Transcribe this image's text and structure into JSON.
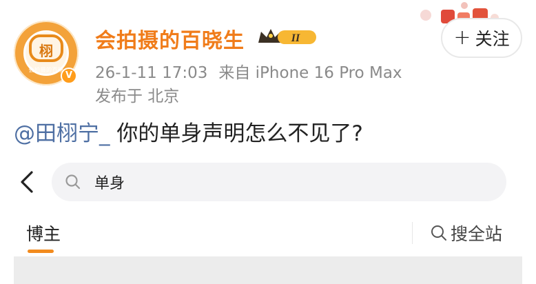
{
  "post": {
    "author": {
      "name": "会拍摄的百晓生",
      "avatar_glyph": "栩",
      "avatar_caption": "会拍摄的百晓",
      "verified_mark": "V",
      "level_badge": "II",
      "level_icon": "crown-icon"
    },
    "meta": {
      "timestamp": "26-1-11 17:03",
      "source": "来自 iPhone 16 Pro Max",
      "location": "发布于 北京"
    },
    "follow_button": {
      "plus": "+",
      "label": "关注"
    },
    "text": {
      "mention": "@田栩宁_",
      "body": " 你的单身声明怎么不见了?"
    }
  },
  "embedded_screenshot": {
    "back_icon": "chevron-left-icon",
    "search": {
      "icon": "search-icon",
      "query": "单身"
    },
    "tabs": {
      "active": "博主"
    },
    "search_all": {
      "icon": "search-icon",
      "label": "搜全站"
    }
  },
  "colors": {
    "username": "#f07c1a",
    "mention": "#4e6fa3",
    "meta": "#8a8a8a",
    "tab_underline": "#f28b1e"
  }
}
